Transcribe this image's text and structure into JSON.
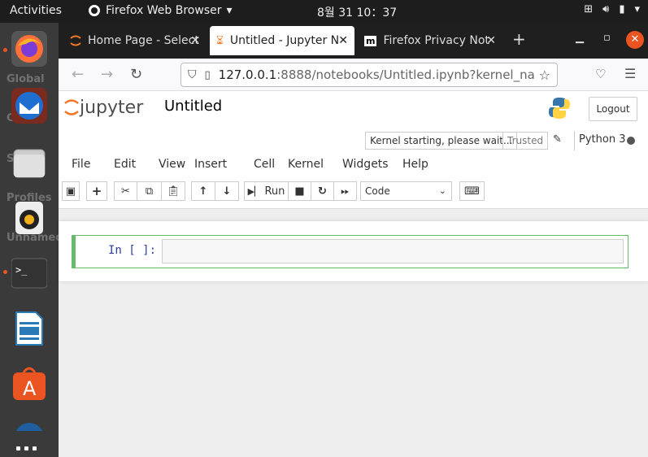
{
  "topbar": {
    "activities": "Activities",
    "app_name": "Firefox Web Browser",
    "clock": "8월 31  10：37"
  },
  "dock": {
    "ghost_labels": [
      "Global",
      "Conta",
      "S        ts",
      "Profiles",
      "Unnamed"
    ]
  },
  "browser": {
    "tabs": [
      {
        "title": "Home Page - Select",
        "icon": "jupyter-icon"
      },
      {
        "title": "Untitled - Jupyter N",
        "icon": "hourglass-icon"
      },
      {
        "title": "Firefox Privacy Not",
        "icon": "mozilla-icon"
      }
    ],
    "url_host": "127.0.0.1",
    "url_rest": ":8888/notebooks/Untitled.ipynb?kernel_nam"
  },
  "jupyter": {
    "logo_text": "jupyter",
    "notebook_title": "Untitled",
    "logout": "Logout",
    "kernel_status": "Kernel starting, please wait...",
    "trusted": "Trusted",
    "kernel_name": "Python 3",
    "menus": [
      "File",
      "Edit",
      "View",
      "Insert",
      "Cell",
      "Kernel",
      "Widgets",
      "Help"
    ],
    "run_label": "Run",
    "cell_type": "Code",
    "prompt": "In [ ]:"
  },
  "colors": {
    "accent": "#e95420",
    "cell_border": "#66bb6a",
    "prompt": "#303f9f"
  }
}
